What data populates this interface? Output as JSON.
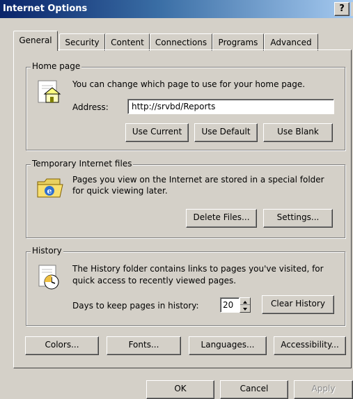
{
  "window": {
    "title": "Internet Options",
    "help_label": "?"
  },
  "tabs": [
    {
      "label": "General"
    },
    {
      "label": "Security"
    },
    {
      "label": "Content"
    },
    {
      "label": "Connections"
    },
    {
      "label": "Programs"
    },
    {
      "label": "Advanced"
    }
  ],
  "home_page": {
    "legend": "Home page",
    "description": "You can change which page to use for your home page.",
    "address_label": "Address:",
    "address_value": "http://srvbd/Reports",
    "use_current": "Use Current",
    "use_default": "Use Default",
    "use_blank": "Use Blank",
    "icon": "home-page-icon"
  },
  "temp_files": {
    "legend": "Temporary Internet files",
    "description_line1": "Pages you view on the Internet are stored in a special folder",
    "description_line2": "for quick viewing later.",
    "delete_files": "Delete Files...",
    "settings": "Settings...",
    "icon": "internet-folder-icon"
  },
  "history": {
    "legend": "History",
    "description_line1": "The History folder contains links to pages you've visited, for",
    "description_line2": "quick access to recently viewed pages.",
    "days_label": "Days to keep pages in history:",
    "days_value": "20",
    "clear_history": "Clear History",
    "icon": "history-icon"
  },
  "bottom_buttons": {
    "colors": "Colors...",
    "fonts": "Fonts...",
    "languages": "Languages...",
    "accessibility": "Accessibility..."
  },
  "dialog_buttons": {
    "ok": "OK",
    "cancel": "Cancel",
    "apply": "Apply"
  },
  "colors": {
    "titlebar_start": "#0a246a",
    "titlebar_end": "#a6caf0",
    "face": "#d4d0c8"
  }
}
